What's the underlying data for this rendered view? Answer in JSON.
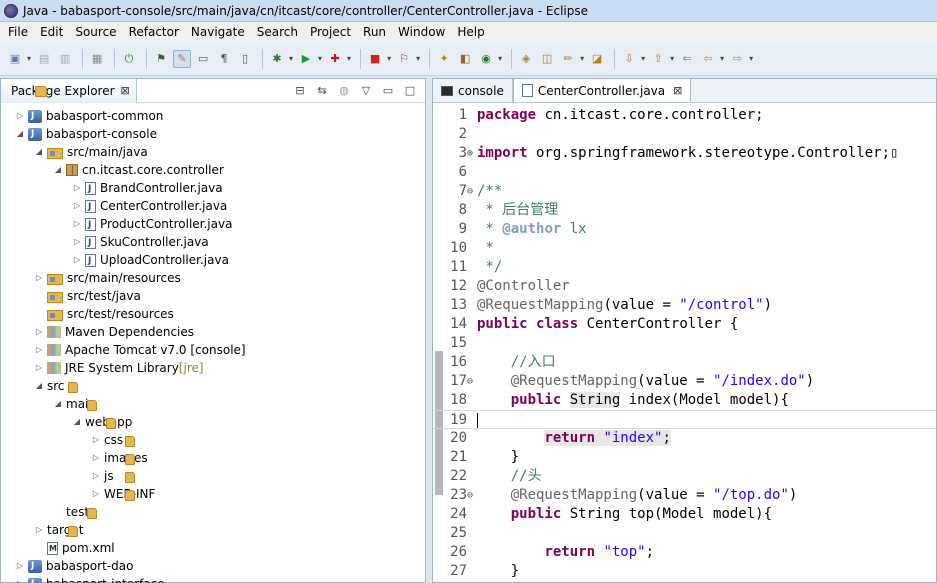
{
  "window": {
    "title": "Java - babasport-console/src/main/java/cn/itcast/core/controller/CenterController.java - Eclipse"
  },
  "menu": [
    "File",
    "Edit",
    "Source",
    "Refactor",
    "Navigate",
    "Search",
    "Project",
    "Run",
    "Window",
    "Help"
  ],
  "package_explorer": {
    "title": "Package Explorer",
    "close": "⊠",
    "items": [
      {
        "label": "babasport-common",
        "depth": 0,
        "arrow": "▷",
        "icon": "proj"
      },
      {
        "label": "babasport-console",
        "depth": 0,
        "arrow": "◢",
        "icon": "proj"
      },
      {
        "label": "src/main/java",
        "depth": 1,
        "arrow": "◢",
        "icon": "srcfold"
      },
      {
        "label": "cn.itcast.core.controller",
        "depth": 2,
        "arrow": "◢",
        "icon": "pkg"
      },
      {
        "label": "BrandController.java",
        "depth": 3,
        "arrow": "▷",
        "icon": "jfile"
      },
      {
        "label": "CenterController.java",
        "depth": 3,
        "arrow": "▷",
        "icon": "jfile"
      },
      {
        "label": "ProductController.java",
        "depth": 3,
        "arrow": "▷",
        "icon": "jfile"
      },
      {
        "label": "SkuController.java",
        "depth": 3,
        "arrow": "▷",
        "icon": "jfile"
      },
      {
        "label": "UploadController.java",
        "depth": 3,
        "arrow": "▷",
        "icon": "jfile"
      },
      {
        "label": "src/main/resources",
        "depth": 1,
        "arrow": "▷",
        "icon": "srcfold"
      },
      {
        "label": "src/test/java",
        "depth": 1,
        "arrow": "",
        "icon": "srcfold"
      },
      {
        "label": "src/test/resources",
        "depth": 1,
        "arrow": "",
        "icon": "srcfold"
      },
      {
        "label": "Maven Dependencies",
        "depth": 1,
        "arrow": "▷",
        "icon": "lib"
      },
      {
        "label": "Apache Tomcat v7.0 [console]",
        "depth": 1,
        "arrow": "▷",
        "icon": "lib"
      },
      {
        "label": "JRE System Library",
        "deco": "[jre]",
        "depth": 1,
        "arrow": "▷",
        "icon": "lib"
      },
      {
        "label": "src",
        "depth": 1,
        "arrow": "◢",
        "icon": "fold"
      },
      {
        "label": "main",
        "depth": 2,
        "arrow": "◢",
        "icon": "fold"
      },
      {
        "label": "webapp",
        "depth": 3,
        "arrow": "◢",
        "icon": "fold"
      },
      {
        "label": "css",
        "depth": 4,
        "arrow": "▷",
        "icon": "fold"
      },
      {
        "label": "images",
        "depth": 4,
        "arrow": "▷",
        "icon": "fold"
      },
      {
        "label": "js",
        "depth": 4,
        "arrow": "▷",
        "icon": "fold"
      },
      {
        "label": "WEB-INF",
        "depth": 4,
        "arrow": "▷",
        "icon": "fold"
      },
      {
        "label": "test",
        "depth": 2,
        "arrow": "",
        "icon": "fold"
      },
      {
        "label": "target",
        "depth": 1,
        "arrow": "▷",
        "icon": "fold"
      },
      {
        "label": "pom.xml",
        "depth": 1,
        "arrow": "",
        "icon": "xml"
      },
      {
        "label": "babasport-dao",
        "depth": 0,
        "arrow": "▷",
        "icon": "proj"
      },
      {
        "label": "babasport-interface",
        "depth": 0,
        "arrow": "▷",
        "icon": "proj"
      }
    ]
  },
  "editor": {
    "tabs": [
      {
        "label": "console",
        "active": false
      },
      {
        "label": "CenterController.java",
        "active": true
      }
    ],
    "lines": [
      {
        "n": "1",
        "html": "<span class='kw'>package</span> cn.itcast.core.controller;"
      },
      {
        "n": "2",
        "html": ""
      },
      {
        "n": "3",
        "fold": "⊕",
        "html": "<span class='kw'>import</span> org.springframework.stereotype.Controller;▯"
      },
      {
        "n": "6",
        "html": ""
      },
      {
        "n": "7",
        "fold": "⊖",
        "html": "<span class='cmt'>/**</span>"
      },
      {
        "n": "8",
        "html": "<span class='cmt'> * 后台管理</span>"
      },
      {
        "n": "9",
        "html": "<span class='cmt'> * </span><span class='jdtag'>@author</span><span class='cmt'> lx</span>"
      },
      {
        "n": "10",
        "html": "<span class='cmt'> *</span>"
      },
      {
        "n": "11",
        "html": "<span class='cmt'> */</span>"
      },
      {
        "n": "12",
        "html": "<span class='ann'>@Controller</span>"
      },
      {
        "n": "13",
        "html": "<span class='ann'>@RequestMapping</span>(value = <span class='str'>\"/control\"</span>)"
      },
      {
        "n": "14",
        "html": "<span class='kw'>public</span> <span class='kw'>class</span> CenterController {"
      },
      {
        "n": "15",
        "html": ""
      },
      {
        "n": "16",
        "html": "    <span class='cmt'>//入口</span>"
      },
      {
        "n": "17",
        "fold": "⊖",
        "html": "    <span class='ann'>@RequestMapping</span>(value = <span class='str'>\"/index.do\"</span>)"
      },
      {
        "n": "18",
        "html": "    <span class='kw'>public</span> <span class='hl'>String</span> index(Model model){"
      },
      {
        "n": "19",
        "cur": true,
        "html": "<span class='caret'></span>"
      },
      {
        "n": "20",
        "html": "        <span class='hl'><span class='kw'>return</span> <span class='str'>\"index\"</span>;</span>"
      },
      {
        "n": "21",
        "html": "    }"
      },
      {
        "n": "22",
        "html": "    <span class='cmt'>//头</span>"
      },
      {
        "n": "23",
        "fold": "⊖",
        "html": "    <span class='ann'>@RequestMapping</span>(value = <span class='str'>\"/top.do\"</span>)"
      },
      {
        "n": "24",
        "html": "    <span class='kw'>public</span> String top(Model model){"
      },
      {
        "n": "25",
        "html": ""
      },
      {
        "n": "26",
        "html": "        <span class='kw'>return</span> <span class='str'>\"top\"</span>;"
      },
      {
        "n": "27",
        "html": "    }"
      }
    ]
  }
}
